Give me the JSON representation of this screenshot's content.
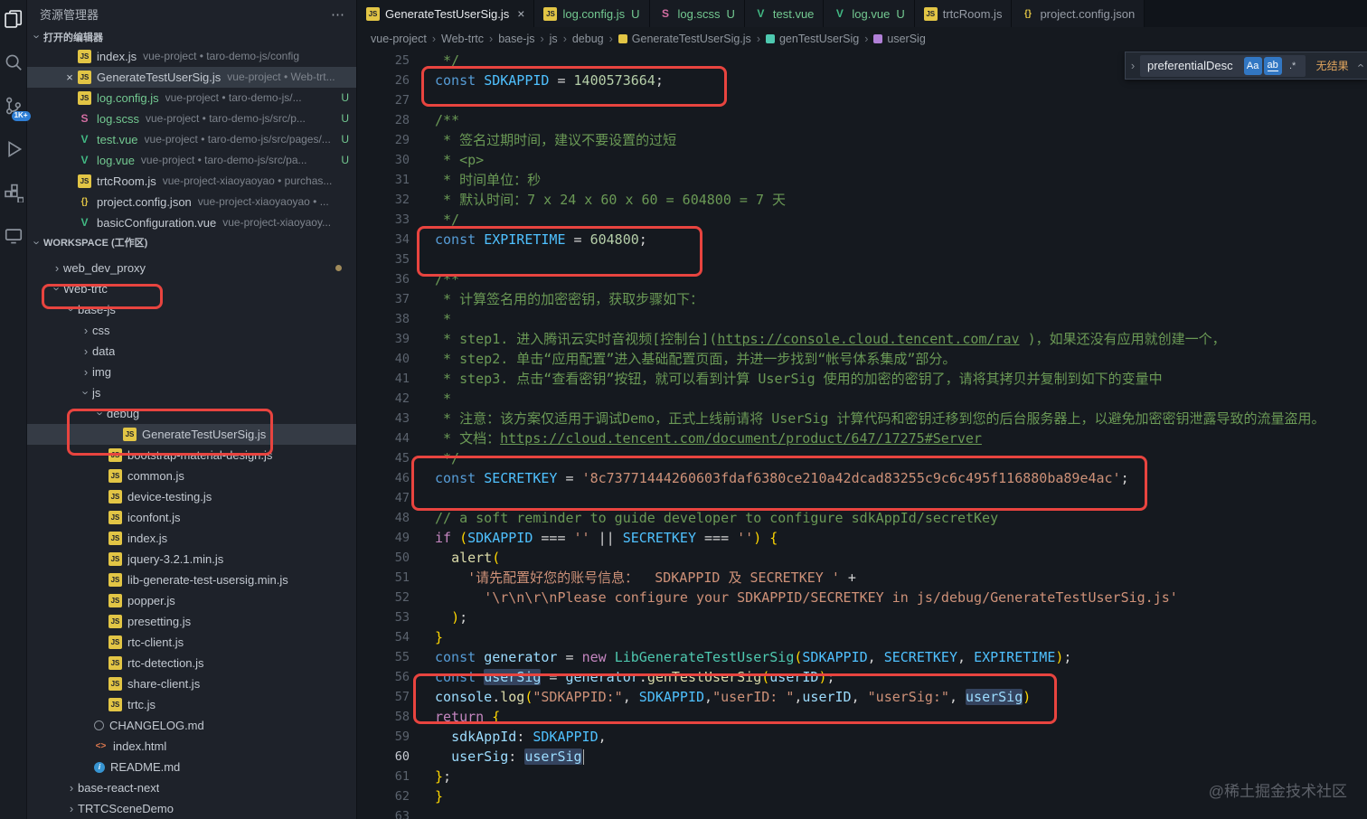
{
  "activity_bar": {
    "badge": "1K+",
    "items": [
      "explorer",
      "search",
      "source-control",
      "run-debug",
      "extensions",
      "remote"
    ]
  },
  "sidebar": {
    "title": "资源管理器",
    "more": "⋯",
    "open_editors": {
      "label": "打开的编辑器",
      "items": [
        {
          "icon": "js",
          "name": "index.js",
          "desc": "vue-project • taro-demo-js/config"
        },
        {
          "icon": "js",
          "name": "GenerateTestUserSig.js",
          "desc": "vue-project • Web-trt...",
          "active": true,
          "close": "×"
        },
        {
          "icon": "js",
          "name": "log.config.js",
          "desc": "vue-project • taro-demo-js/...",
          "badge": "U",
          "green": true
        },
        {
          "icon": "scss",
          "name": "log.scss",
          "desc": "vue-project • taro-demo-js/src/p...",
          "badge": "U",
          "green": true
        },
        {
          "icon": "vue",
          "name": "test.vue",
          "desc": "vue-project • taro-demo-js/src/pages/...",
          "badge": "U",
          "green": true
        },
        {
          "icon": "vue",
          "name": "log.vue",
          "desc": "vue-project • taro-demo-js/src/pa...",
          "badge": "U",
          "green": true
        },
        {
          "icon": "js",
          "name": "trtcRoom.js",
          "desc": "vue-project-xiaoyaoyao • purchas..."
        },
        {
          "icon": "json",
          "name": "project.config.json",
          "desc": "vue-project-xiaoyaoyao • ..."
        },
        {
          "icon": "vue",
          "name": "basicConfiguration.vue",
          "desc": "vue-project-xiaoyaoy..."
        }
      ]
    },
    "workspace": {
      "label": "WORKSPACE (工作区)",
      "tree": [
        {
          "name": "web_dev_proxy",
          "kind": "folder",
          "expanded": false,
          "level": 1,
          "dot": true
        },
        {
          "name": "Web-trtc",
          "kind": "folder",
          "expanded": true,
          "level": 1
        },
        {
          "name": "base-js",
          "kind": "folder",
          "expanded": true,
          "level": 2
        },
        {
          "name": "css",
          "kind": "folder",
          "expanded": false,
          "level": 3
        },
        {
          "name": "data",
          "kind": "folder",
          "expanded": false,
          "level": 3
        },
        {
          "name": "img",
          "kind": "folder",
          "expanded": false,
          "level": 3
        },
        {
          "name": "js",
          "kind": "folder",
          "expanded": true,
          "level": 3
        },
        {
          "name": "debug",
          "kind": "folder",
          "expanded": true,
          "level": 4
        },
        {
          "name": "GenerateTestUserSig.js",
          "kind": "file",
          "icon": "js",
          "level": 5,
          "selected": true
        },
        {
          "name": "bootstrap-material-design.js",
          "kind": "file",
          "icon": "js",
          "level": 4
        },
        {
          "name": "common.js",
          "kind": "file",
          "icon": "js",
          "level": 4
        },
        {
          "name": "device-testing.js",
          "kind": "file",
          "icon": "js",
          "level": 4
        },
        {
          "name": "iconfont.js",
          "kind": "file",
          "icon": "js",
          "level": 4
        },
        {
          "name": "index.js",
          "kind": "file",
          "icon": "js",
          "level": 4
        },
        {
          "name": "jquery-3.2.1.min.js",
          "kind": "file",
          "icon": "js",
          "level": 4
        },
        {
          "name": "lib-generate-test-usersig.min.js",
          "kind": "file",
          "icon": "js",
          "level": 4
        },
        {
          "name": "popper.js",
          "kind": "file",
          "icon": "js",
          "level": 4
        },
        {
          "name": "presetting.js",
          "kind": "file",
          "icon": "js",
          "level": 4
        },
        {
          "name": "rtc-client.js",
          "kind": "file",
          "icon": "js",
          "level": 4
        },
        {
          "name": "rtc-detection.js",
          "kind": "file",
          "icon": "js",
          "level": 4
        },
        {
          "name": "share-client.js",
          "kind": "file",
          "icon": "js",
          "level": 4
        },
        {
          "name": "trtc.js",
          "kind": "file",
          "icon": "js",
          "level": 4
        },
        {
          "name": "CHANGELOG.md",
          "kind": "file",
          "icon": "md",
          "level": 3
        },
        {
          "name": "index.html",
          "kind": "file",
          "icon": "html",
          "level": 3
        },
        {
          "name": "README.md",
          "kind": "file",
          "icon": "info",
          "level": 3
        },
        {
          "name": "base-react-next",
          "kind": "folder",
          "expanded": false,
          "level": 2
        },
        {
          "name": "TRTCSceneDemo",
          "kind": "folder",
          "expanded": false,
          "level": 2
        }
      ]
    }
  },
  "tabs": [
    {
      "icon": "js",
      "label": "GenerateTestUserSig.js",
      "active": true,
      "close": "×"
    },
    {
      "icon": "js",
      "label": "log.config.js",
      "badge": "U",
      "green": true
    },
    {
      "icon": "scss",
      "label": "log.scss",
      "badge": "U",
      "green": true
    },
    {
      "icon": "vue",
      "label": "test.vue",
      "green": true
    },
    {
      "icon": "vue",
      "label": "log.vue",
      "badge": "U",
      "green": true
    },
    {
      "icon": "js",
      "label": "trtcRoom.js"
    },
    {
      "icon": "json",
      "label": "project.config.json"
    }
  ],
  "breadcrumb": [
    {
      "label": "vue-project"
    },
    {
      "label": "Web-trtc"
    },
    {
      "label": "base-js"
    },
    {
      "label": "js"
    },
    {
      "label": "debug"
    },
    {
      "label": "GenerateTestUserSig.js",
      "icon": "js"
    },
    {
      "label": "genTestUserSig",
      "icon": "sym-method"
    },
    {
      "label": "userSig",
      "icon": "sym-var"
    }
  ],
  "find": {
    "query": "preferentialDesc",
    "match_case": "Aa",
    "whole_word": "ab",
    "regex": ".*",
    "result": "无结果"
  },
  "editor": {
    "current_line": 60,
    "lines": [
      {
        "n": 25,
        "seg": [
          [
            "cm",
            " */"
          ]
        ]
      },
      {
        "n": 26,
        "seg": [
          [
            "kw",
            "const"
          ],
          [
            "tx",
            " "
          ],
          [
            "cn",
            "SDKAPPID"
          ],
          [
            "tx",
            " = "
          ],
          [
            "nm",
            "1400573664"
          ],
          [
            "pc",
            ";"
          ]
        ]
      },
      {
        "n": 27,
        "seg": []
      },
      {
        "n": 28,
        "seg": [
          [
            "cm",
            "/**"
          ]
        ]
      },
      {
        "n": 29,
        "seg": [
          [
            "cm",
            " * 签名过期时间，建议不要设置的过短"
          ]
        ]
      },
      {
        "n": 30,
        "seg": [
          [
            "cm",
            " * <p>"
          ]
        ]
      },
      {
        "n": 31,
        "seg": [
          [
            "cm",
            " * 时间单位：秒"
          ]
        ]
      },
      {
        "n": 32,
        "seg": [
          [
            "cm",
            " * 默认时间：7 x 24 x 60 x 60 = 604800 = 7 天"
          ]
        ]
      },
      {
        "n": 33,
        "seg": [
          [
            "cm",
            " */"
          ]
        ]
      },
      {
        "n": 34,
        "seg": [
          [
            "kw",
            "const"
          ],
          [
            "tx",
            " "
          ],
          [
            "cn",
            "EXPIRETIME"
          ],
          [
            "tx",
            " = "
          ],
          [
            "nm",
            "604800"
          ],
          [
            "pc",
            ";"
          ]
        ]
      },
      {
        "n": 35,
        "seg": []
      },
      {
        "n": 36,
        "seg": [
          [
            "cm",
            "/**"
          ]
        ]
      },
      {
        "n": 37,
        "seg": [
          [
            "cm",
            " * 计算签名用的加密密钥，获取步骤如下："
          ]
        ]
      },
      {
        "n": 38,
        "seg": [
          [
            "cm",
            " *"
          ]
        ]
      },
      {
        "n": 39,
        "seg": [
          [
            "cm",
            " * step1. 进入腾讯云实时音视频[控制台]("
          ],
          [
            "lk",
            "https://console.cloud.tencent.com/rav"
          ],
          [
            "cm",
            " )，如果还没有应用就创建一个，"
          ]
        ]
      },
      {
        "n": 40,
        "seg": [
          [
            "cm",
            " * step2. 单击“应用配置”进入基础配置页面，并进一步找到“帐号体系集成”部分。"
          ]
        ]
      },
      {
        "n": 41,
        "seg": [
          [
            "cm",
            " * step3. 点击“查看密钥”按钮，就可以看到计算 UserSig 使用的加密的密钥了，请将其拷贝并复制到如下的变量中"
          ]
        ]
      },
      {
        "n": 42,
        "seg": [
          [
            "cm",
            " *"
          ]
        ]
      },
      {
        "n": 43,
        "seg": [
          [
            "cm",
            " * 注意：该方案仅适用于调试Demo，正式上线前请将 UserSig 计算代码和密钥迁移到您的后台服务器上，以避免加密密钥泄露导致的流量盗用。"
          ]
        ]
      },
      {
        "n": 44,
        "seg": [
          [
            "cm",
            " * 文档："
          ],
          [
            "lk",
            "https://cloud.tencent.com/document/product/647/17275#Server"
          ]
        ]
      },
      {
        "n": 45,
        "seg": [
          [
            "cm",
            " */"
          ]
        ]
      },
      {
        "n": 46,
        "seg": [
          [
            "kw",
            "const"
          ],
          [
            "tx",
            " "
          ],
          [
            "cn",
            "SECRETKEY"
          ],
          [
            "tx",
            " = "
          ],
          [
            "st",
            "'8c73771444260603fdaf6380ce210a42dcad83255c9c6c495f116880ba89e4ac'"
          ],
          [
            "pc",
            ";"
          ]
        ]
      },
      {
        "n": 47,
        "seg": []
      },
      {
        "n": 48,
        "seg": [
          [
            "cm",
            "// a soft reminder to guide developer to configure sdkAppId/secretKey"
          ]
        ]
      },
      {
        "n": 49,
        "seg": [
          [
            "kw2",
            "if"
          ],
          [
            "tx",
            " "
          ],
          [
            "br",
            "("
          ],
          [
            "cn",
            "SDKAPPID"
          ],
          [
            "tx",
            " === "
          ],
          [
            "st",
            "''"
          ],
          [
            "tx",
            " || "
          ],
          [
            "cn",
            "SECRETKEY"
          ],
          [
            "tx",
            " === "
          ],
          [
            "st",
            "''"
          ],
          [
            "br",
            ")"
          ],
          [
            "tx",
            " "
          ],
          [
            "br",
            "{"
          ]
        ]
      },
      {
        "n": 50,
        "seg": [
          [
            "tx",
            "  "
          ],
          [
            "fn",
            "alert"
          ],
          [
            "br",
            "("
          ]
        ]
      },
      {
        "n": 51,
        "seg": [
          [
            "tx",
            "    "
          ],
          [
            "st",
            "'请先配置好您的账号信息：  SDKAPPID 及 SECRETKEY '"
          ],
          [
            "tx",
            " +"
          ]
        ]
      },
      {
        "n": 52,
        "seg": [
          [
            "tx",
            "      "
          ],
          [
            "st",
            "'\\r\\n\\r\\nPlease configure your SDKAPPID/SECRETKEY in js/debug/GenerateTestUserSig.js'"
          ]
        ]
      },
      {
        "n": 53,
        "seg": [
          [
            "tx",
            "  "
          ],
          [
            "br",
            ")"
          ],
          [
            "pc",
            ";"
          ]
        ]
      },
      {
        "n": 54,
        "seg": [
          [
            "br",
            "}"
          ]
        ]
      },
      {
        "n": 55,
        "seg": [
          [
            "kw",
            "const"
          ],
          [
            "tx",
            " "
          ],
          [
            "vr",
            "generator"
          ],
          [
            "tx",
            " = "
          ],
          [
            "kw2",
            "new"
          ],
          [
            "tx",
            " "
          ],
          [
            "cl",
            "LibGenerateTestUserSig"
          ],
          [
            "br",
            "("
          ],
          [
            "cn",
            "SDKAPPID"
          ],
          [
            "pc",
            ", "
          ],
          [
            "cn",
            "SECRETKEY"
          ],
          [
            "pc",
            ", "
          ],
          [
            "cn",
            "EXPIRETIME"
          ],
          [
            "br",
            ")"
          ],
          [
            "pc",
            ";"
          ]
        ]
      },
      {
        "n": 56,
        "seg": [
          [
            "kw",
            "const"
          ],
          [
            "tx",
            " "
          ],
          [
            "vr occ",
            "userSig"
          ],
          [
            "tx",
            " = "
          ],
          [
            "vr",
            "generator"
          ],
          [
            "pc",
            "."
          ],
          [
            "fn",
            "genTestUserSig"
          ],
          [
            "br",
            "("
          ],
          [
            "vr",
            "userID"
          ],
          [
            "br",
            ")"
          ],
          [
            "pc",
            ";"
          ]
        ]
      },
      {
        "n": 57,
        "seg": [
          [
            "vr",
            "console"
          ],
          [
            "pc",
            "."
          ],
          [
            "fn",
            "log"
          ],
          [
            "br",
            "("
          ],
          [
            "st",
            "\"SDKAPPID:\""
          ],
          [
            "pc",
            ", "
          ],
          [
            "cn",
            "SDKAPPID"
          ],
          [
            "pc",
            ","
          ],
          [
            "st",
            "\"userID: \""
          ],
          [
            "pc",
            ","
          ],
          [
            "vr",
            "userID"
          ],
          [
            "pc",
            ", "
          ],
          [
            "st",
            "\"userSig:\""
          ],
          [
            "pc",
            ", "
          ],
          [
            "vr occ",
            "userSig"
          ],
          [
            "br",
            ")"
          ]
        ]
      },
      {
        "n": 58,
        "seg": [
          [
            "kw2",
            "return"
          ],
          [
            "tx",
            " "
          ],
          [
            "br",
            "{"
          ]
        ]
      },
      {
        "n": 59,
        "seg": [
          [
            "tx",
            "  "
          ],
          [
            "vr",
            "sdkAppId"
          ],
          [
            "pc",
            ": "
          ],
          [
            "cn",
            "SDKAPPID"
          ],
          [
            "pc",
            ","
          ]
        ]
      },
      {
        "n": 60,
        "seg": [
          [
            "tx",
            "  "
          ],
          [
            "vr",
            "userSig"
          ],
          [
            "pc",
            ": "
          ],
          [
            "vr occ",
            "userSig"
          ],
          [
            "cursor",
            ""
          ]
        ]
      },
      {
        "n": 61,
        "seg": [
          [
            "br",
            "}"
          ],
          [
            "pc",
            ";"
          ]
        ]
      },
      {
        "n": 62,
        "seg": [
          [
            "br",
            "}"
          ]
        ]
      },
      {
        "n": 63,
        "seg": []
      }
    ]
  },
  "watermark": "@稀土掘金技术社区"
}
